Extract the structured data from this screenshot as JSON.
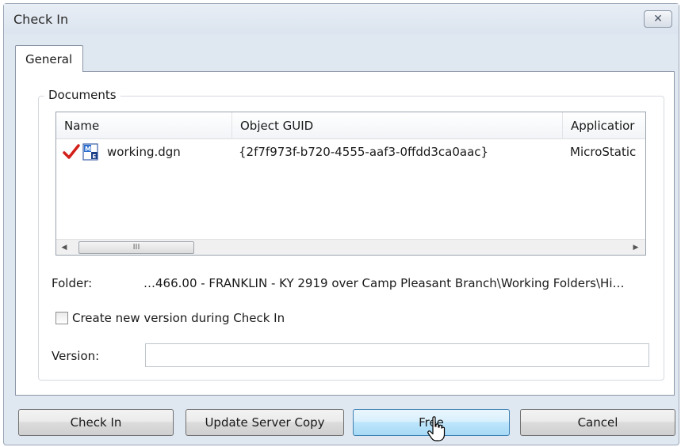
{
  "window": {
    "title": "Check In",
    "close_icon": "close-icon"
  },
  "tabs": [
    {
      "label": "General",
      "selected": true
    }
  ],
  "documents": {
    "group_label": "Documents",
    "columns": [
      "Name",
      "Object GUID",
      "Applicatior"
    ],
    "rows": [
      {
        "name": "working.dgn",
        "guid": "{2f7f973f-b720-4555-aaf3-0ffdd3ca0aac}",
        "application": "MicroStatic",
        "check_icon": "checkmark-icon",
        "file_icon": "microstation-file-icon"
      }
    ],
    "scrollbar": {
      "thumb_label": "III"
    }
  },
  "folder": {
    "label": "Folder:",
    "value": "…466.00 - FRANKLIN - KY 2919 over Camp Pleasant Branch\\Working Folders\\Hi…"
  },
  "create_version": {
    "label": "Create new version during Check In",
    "checked": false
  },
  "version": {
    "label": "Version:",
    "value": ""
  },
  "buttons": {
    "check_in": "Check In",
    "update_server_copy": "Update Server Copy",
    "free": "Free",
    "cancel": "Cancel"
  },
  "colors": {
    "dialog_bg": "#dfe7f1",
    "check_mark": "#d2201a",
    "button_hover": "#bee6fd"
  }
}
